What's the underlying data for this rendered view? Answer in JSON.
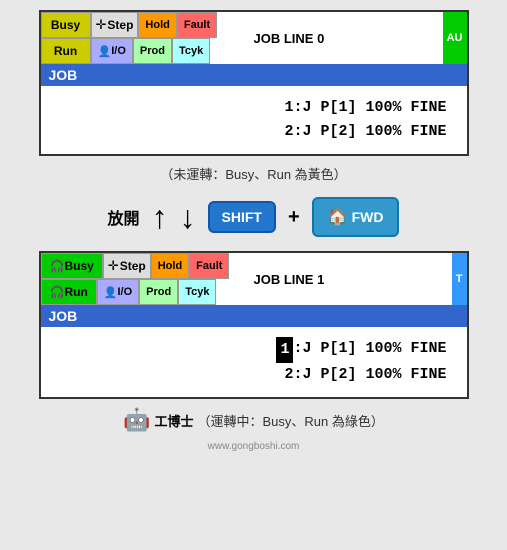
{
  "panel1": {
    "busy_label": "Busy",
    "run_label": "Run",
    "step_label": "Step",
    "hold_label": "Hold",
    "fault_label": "Fault",
    "io_label": "I/O",
    "prod_label": "Prod",
    "tcyk_label": "Tcyk",
    "job_line_label": "JOB LINE 0",
    "auto_label": "AU",
    "job_bar_label": "JOB",
    "line1": "1:J   P[1]  100%  FINE",
    "line2": "2:J   P[2]  100%  FINE"
  },
  "caption1": "（未運轉：Busy、Run 為黃色）",
  "controls": {
    "release_label": "放開",
    "shift_label": "SHIFT",
    "plus_label": "+",
    "fwd_label": "FWD"
  },
  "panel2": {
    "busy_label": "Busy",
    "run_label": "Run",
    "step_label": "Step",
    "hold_label": "Hold",
    "fault_label": "Fault",
    "io_label": "I/O",
    "prod_label": "Prod",
    "tcyk_label": "Tcyk",
    "job_line_label": "JOB LINE 1",
    "auto_label": "T",
    "job_bar_label": "JOB",
    "line1_num": "1",
    "line1_rest": ":J   P[1]  100%  FINE",
    "line2": "2:J   P[2]  100%  FINE"
  },
  "caption2": "（運轉中：Busy、Run 為綠色）",
  "watermark": {
    "site": "www.gongboshi.com",
    "label": "工博士"
  }
}
